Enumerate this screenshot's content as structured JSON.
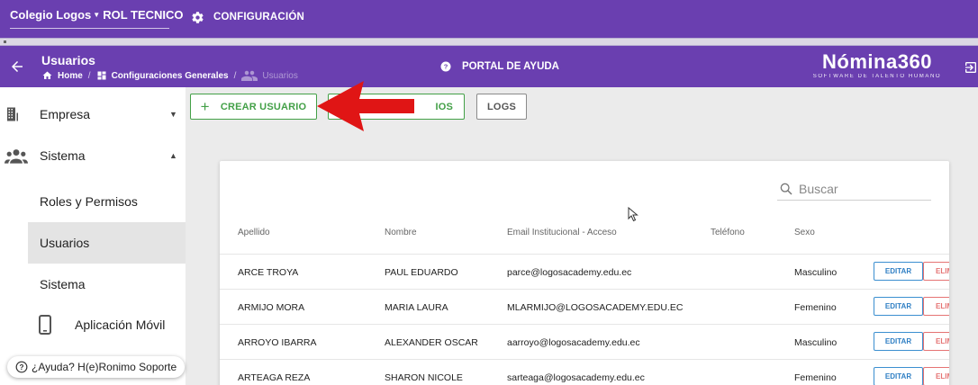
{
  "topbar": {
    "school": "Colegio Logos",
    "role": "ROL TECNICO",
    "config_label": "CONFIGURACIÓN"
  },
  "header": {
    "title": "Usuarios",
    "breadcrumb": [
      "Home",
      "Configuraciones Generales",
      "Usuarios"
    ],
    "help_portal": "PORTAL DE AYUDA",
    "brand_name": "Nómina360",
    "brand_tagline": "SOFTWARE DE TALENTO HUMANO"
  },
  "sidebar": {
    "items": [
      {
        "label": "Empresa",
        "icon": "building-icon",
        "expanded": false
      },
      {
        "label": "Sistema",
        "icon": "people-icon",
        "expanded": true
      }
    ],
    "sub_items": [
      {
        "label": "Roles y Permisos",
        "active": false
      },
      {
        "label": "Usuarios",
        "active": true
      },
      {
        "label": "Sistema",
        "active": false
      },
      {
        "label": "Aplicación Móvil",
        "active": false,
        "icon": "mobile-phone-icon"
      }
    ],
    "help_chip": "¿Ayuda? H(e)Ronimo Soporte"
  },
  "toolbar": {
    "create_label": "CREAR USUARIO",
    "import_label_visible": "IOS",
    "logs_label": "LOGS"
  },
  "search": {
    "placeholder": "Buscar"
  },
  "table": {
    "columns": [
      "Apellido",
      "Nombre",
      "Email Institucional - Acceso",
      "Teléfono",
      "Sexo"
    ],
    "edit_label": "EDITAR",
    "delete_label_visible": "ELIM",
    "rows": [
      {
        "apellido": "ARCE TROYA",
        "nombre": "PAUL EDUARDO",
        "email": "parce@logosacademy.edu.ec",
        "telefono": "",
        "sexo": "Masculino"
      },
      {
        "apellido": "ARMIJO MORA",
        "nombre": "MARIA LAURA",
        "email": "MLARMIJO@LOGOSACADEMY.EDU.EC",
        "telefono": "",
        "sexo": "Femenino"
      },
      {
        "apellido": "ARROYO IBARRA",
        "nombre": "ALEXANDER OSCAR",
        "email": "aarroyo@logosacademy.edu.ec",
        "telefono": "",
        "sexo": "Masculino"
      },
      {
        "apellido": "ARTEAGA REZA",
        "nombre": "SHARON NICOLE",
        "email": "sarteaga@logosacademy.edu.ec",
        "telefono": "",
        "sexo": "Femenino"
      }
    ]
  },
  "colors": {
    "primary": "#6a3fb0",
    "success": "#43a047",
    "info": "#3b8fd0",
    "danger": "#e57373",
    "annotation_arrow": "#e01515"
  }
}
